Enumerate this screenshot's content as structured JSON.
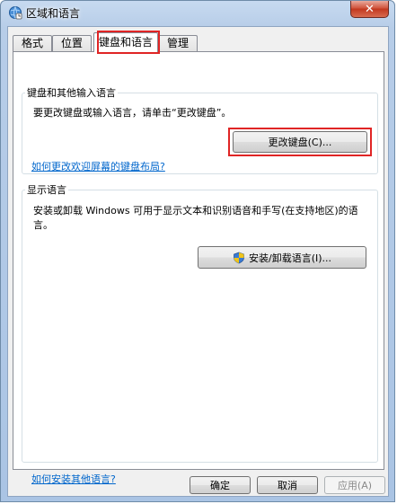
{
  "window": {
    "title": "区域和语言",
    "close_glyph": "✕"
  },
  "tabs": [
    {
      "label": "格式",
      "active": false
    },
    {
      "label": "位置",
      "active": false
    },
    {
      "label": "键盘和语言",
      "active": true
    },
    {
      "label": "管理",
      "active": false
    }
  ],
  "keyboard_group": {
    "title": "键盘和其他输入语言",
    "description": "要更改键盘或输入语言，请单击“更改键盘”。",
    "change_button": "更改键盘(C)...",
    "link": "如何更改欢迎屏幕的键盘布局?"
  },
  "display_group": {
    "title": "显示语言",
    "description_line1": "安装或卸载 Windows 可用于显示文本和识别语音和手写(在支持地区)的语",
    "description_line2": "言。",
    "install_button": "安装/卸载语言(I)...",
    "install_icon": "uac-shield-icon"
  },
  "bottom_link": "如何安装其他语言?",
  "footer": {
    "ok": "确定",
    "cancel": "取消",
    "apply": "应用(A)"
  },
  "highlight_color": "#e02525"
}
